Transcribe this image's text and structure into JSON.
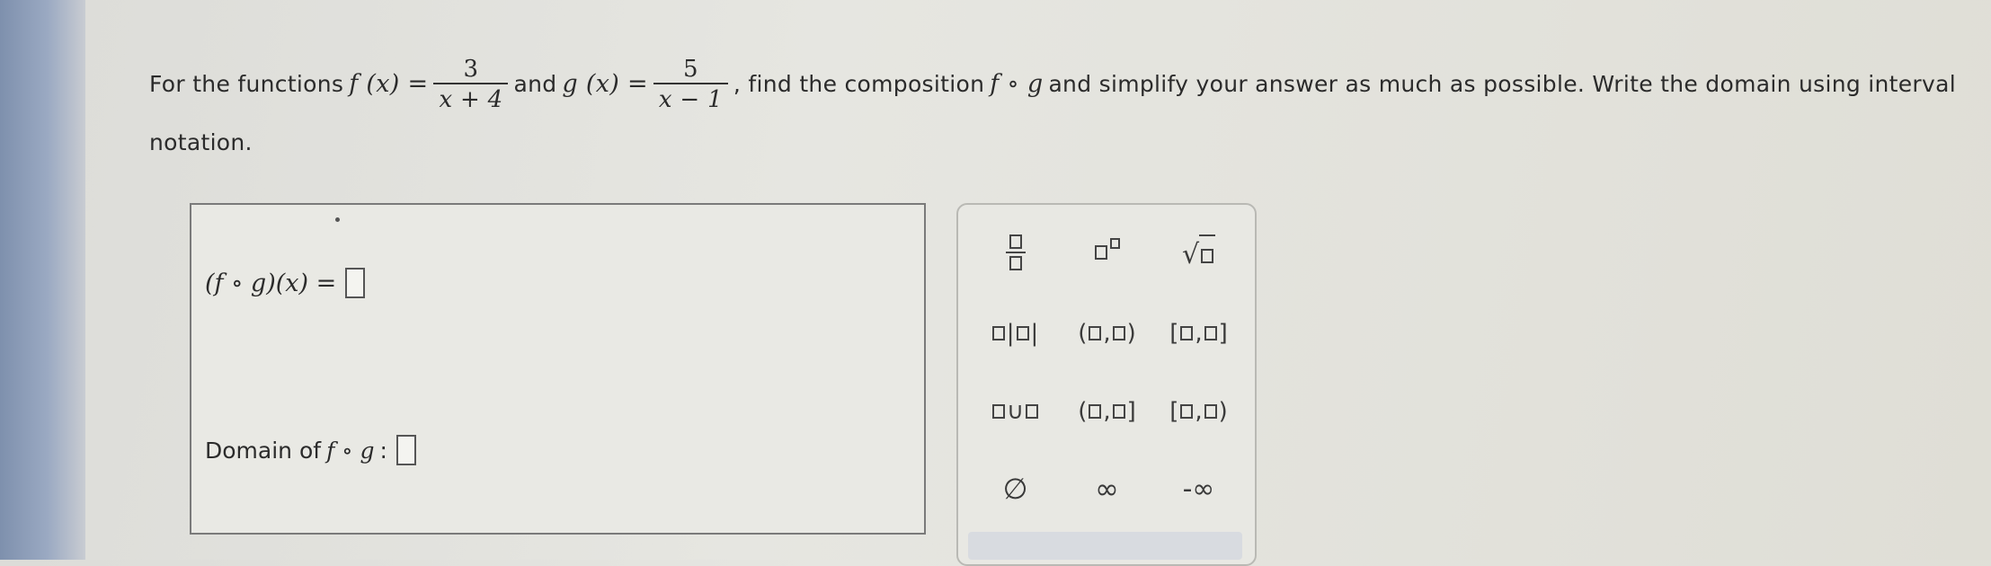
{
  "problem": {
    "intro": "For the functions",
    "f_name": "f (x) =",
    "f_num": "3",
    "f_den": "x + 4",
    "and": "and",
    "g_name": "g (x) =",
    "g_num": "5",
    "g_den": "x − 1",
    "middle": ", find the composition",
    "composition_symbol": "f ∘ g",
    "end_line1": "and simplify your answer as much as possible. Write the domain using interval",
    "line2": "notation."
  },
  "answer_box": {
    "composition_label": "(f ∘ g)(x) =",
    "domain_label": "Domain of",
    "domain_fn": "f ∘ g",
    "domain_colon": ":"
  },
  "palette": {
    "comma": ",",
    "union": "∪",
    "interval_open_open": [
      "(",
      ")"
    ],
    "interval_closed_closed": [
      "[",
      "]"
    ],
    "interval_open_closed": [
      "(",
      "]"
    ],
    "interval_closed_open": [
      "[",
      ")"
    ],
    "empty_set": "∅",
    "infinity": "∞",
    "neg_infinity": "-∞"
  }
}
